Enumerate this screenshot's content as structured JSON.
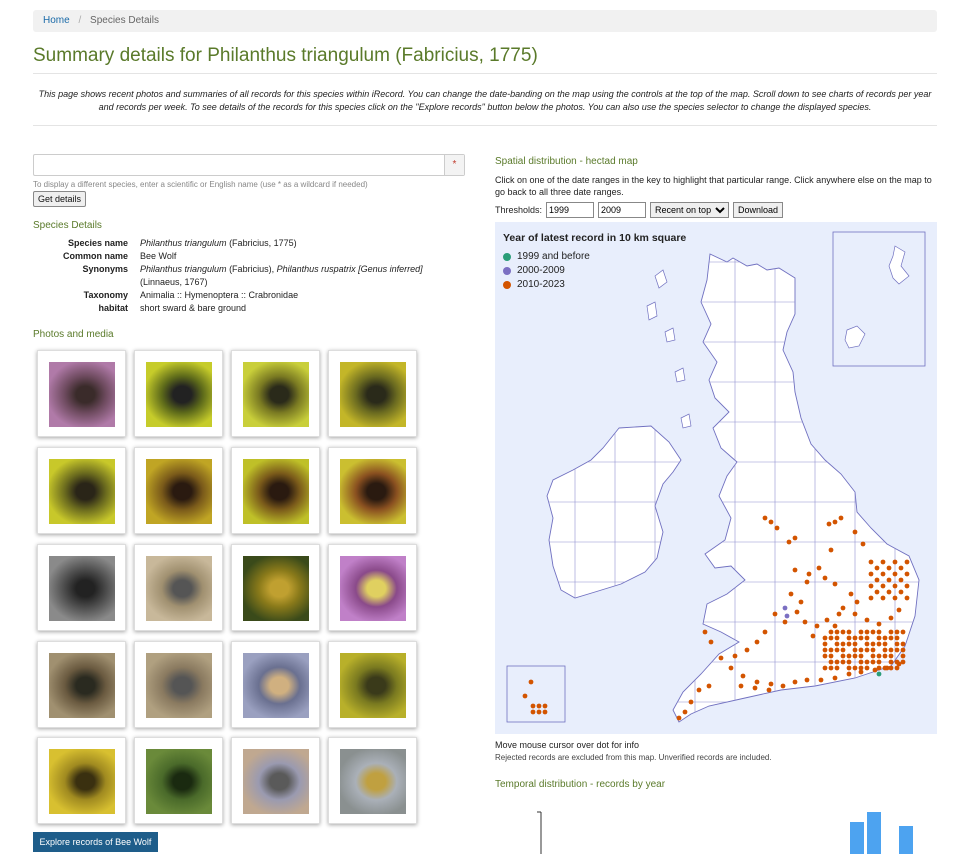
{
  "breadcrumb": {
    "home": "Home",
    "separator": "/",
    "current": "Species Details"
  },
  "title": "Summary details for Philanthus triangulum (Fabricius, 1775)",
  "intro": "This page shows recent photos and summaries of all records for this species within iRecord. You can change the date-banding on the map using the controls at the top of the map. Scroll down to see charts of records per year and records per week. To see details of the records for this species click on the \"Explore records\" button below the photos. You can also use the species selector to change the displayed species.",
  "species_search": {
    "value": "",
    "placeholder": "",
    "required_mark": "*",
    "help": "To display a different species, enter a scientific or English name (use * as a wildcard if needed)",
    "button": "Get details"
  },
  "species_details": {
    "heading": "Species Details",
    "rows": {
      "species_name": {
        "label": "Species name",
        "value_italic": "Philanthus triangulum",
        "value_rest": " (Fabricius, 1775)"
      },
      "common_name": {
        "label": "Common name",
        "value": "Bee Wolf"
      },
      "synonyms": {
        "label": "Synonyms",
        "v1": "Philanthus triangulum",
        "v2": " (Fabricius), ",
        "v3": "Philanthus ruspatrix [Genus inferred]",
        "v4": " (Linnaeus, 1767)"
      },
      "taxonomy": {
        "label": "Taxonomy",
        "value": "Animalia :: Hymenoptera :: Crabronidae"
      },
      "habitat": {
        "label": "habitat",
        "value": "short sward & bare ground"
      }
    }
  },
  "photos": {
    "heading": "Photos and media",
    "explore_button": "Explore records of Bee Wolf"
  },
  "map": {
    "heading": "Spatial distribution - hectad map",
    "instructions": "Click on one of the date ranges in the key to highlight that particular range. Click anywhere else on the map to go back to all three date ranges.",
    "thresholds_label": "Thresholds:",
    "threshold1": "1999",
    "threshold2": "2009",
    "order_select": "Recent on top",
    "download": "Download",
    "legend_title": "Year of latest record in 10 km square",
    "legend": [
      {
        "label": "1999 and before",
        "color": "#2a9d78"
      },
      {
        "label": "2000-2009",
        "color": "#7b6fc2"
      },
      {
        "label": "2010-2023",
        "color": "#d35400"
      }
    ],
    "note1": "Move mouse cursor over dot for info",
    "note2": "Rejected records are excluded from this map. Unverified records are included."
  },
  "temporal": {
    "heading": "Temporal distribution - records by year"
  },
  "colors": {
    "accent_green": "#5a7a2a",
    "link_blue": "#1a6aa8",
    "button_blue": "#1e5d8a",
    "map_bg": "#e8eefc",
    "bar_blue": "#4da3f0"
  }
}
